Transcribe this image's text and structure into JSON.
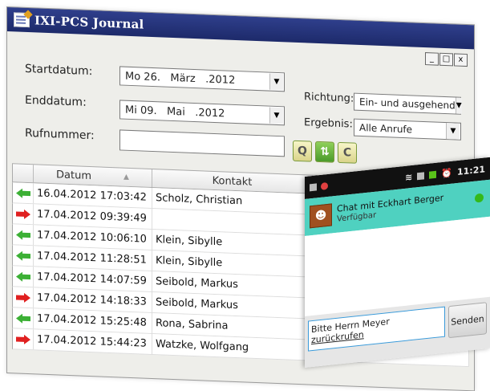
{
  "window": {
    "title": "IXI-PCS Journal",
    "buttons": {
      "minimize": "_",
      "maximize": "□",
      "close": "x"
    }
  },
  "form": {
    "start_label": "Startdatum:",
    "start_value": "Mo 26.   März   .2012",
    "end_label": "Enddatum:",
    "end_value": "Mi 09.   Mai   .2012",
    "direction_label": "Richtung:",
    "direction_value": "Ein- und ausgehend",
    "result_label": "Ergebnis:",
    "result_value": "Alle Anrufe",
    "number_label": "Rufnummer:",
    "number_value": "",
    "search_icon_label": "Q",
    "clear_icon_label": "C"
  },
  "table": {
    "headers": {
      "date": "Datum",
      "contact": "Kontakt"
    },
    "rows": [
      {
        "direction": "in",
        "date": "16.04.2012 17:03:42",
        "contact": "Scholz, Christian"
      },
      {
        "direction": "out",
        "date": "17.04.2012 09:39:49",
        "contact": ""
      },
      {
        "direction": "in",
        "date": "17.04.2012 10:06:10",
        "contact": "Klein, Sibylle"
      },
      {
        "direction": "in",
        "date": "17.04.2012 11:28:51",
        "contact": "Klein, Sibylle"
      },
      {
        "direction": "in",
        "date": "17.04.2012 14:07:59",
        "contact": "Seibold, Markus"
      },
      {
        "direction": "out",
        "date": "17.04.2012 14:18:33",
        "contact": "Seibold, Markus"
      },
      {
        "direction": "in",
        "date": "17.04.2012 15:25:48",
        "contact": "Rona, Sabrina"
      },
      {
        "direction": "out",
        "date": "17.04.2012 15:44:23",
        "contact": "Watzke, Wolfgang"
      }
    ]
  },
  "phone": {
    "time": "11:21",
    "chat_title": "Chat mit Eckhart Berger",
    "chat_status": "Verfügbar",
    "message_line1": "Bitte Herrn Meyer",
    "message_line2": "zurückrufen",
    "send_label": "Senden"
  },
  "colors": {
    "incoming": "#3cb035",
    "outgoing": "#e02020",
    "chat_header": "#4fd1c0",
    "titlebar": "#2f3f8c"
  }
}
